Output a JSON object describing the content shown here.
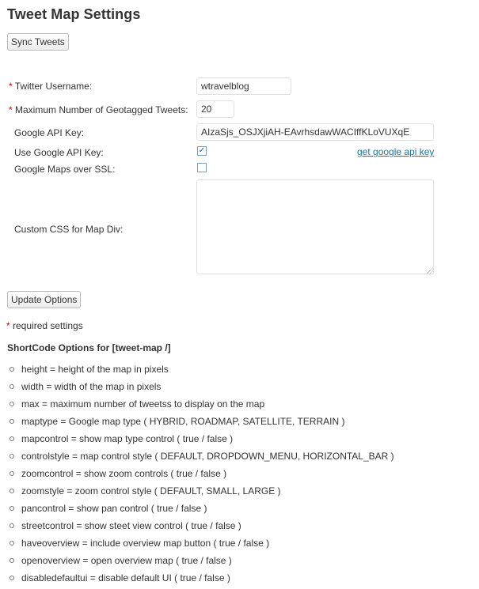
{
  "page": {
    "title": "Tweet Map Settings"
  },
  "sync_button": "Sync Tweets",
  "required_marker": "*",
  "form": {
    "twitter_username": {
      "label": "Twitter Username:",
      "value": "wtravelblog"
    },
    "max_tweets": {
      "label": "Maximum Number of Geotagged Tweets:",
      "value": "20"
    },
    "google_api_key": {
      "label": "Google API Key:",
      "value": "AIzaSjs_OSJXjiAH-EAvrhsdawWACIffKLoVUXqE"
    },
    "use_google_api_key": {
      "label": "Use Google API Key:",
      "checked": true,
      "link": "get google api key"
    },
    "maps_over_ssl": {
      "label": "Google Maps over SSL:",
      "checked": false
    },
    "custom_css": {
      "label": "Custom CSS for Map Div:",
      "value": ""
    }
  },
  "update_button": "Update Options",
  "required_note": "required settings",
  "shortcode": {
    "heading": "ShortCode Options for [tweet-map /]",
    "items": [
      "height = height of the map in pixels",
      "width = width of the map in pixels",
      "max = maximum number of tweetss to display on the map",
      "maptype = Google map type ( HYBRID, ROADMAP, SATELLITE, TERRAIN )",
      "mapcontrol = show map type control ( true / false )",
      "controlstyle = map control style ( DEFAULT, DROPDOWN_MENU, HORIZONTAL_BAR )",
      "zoomcontrol = show zoom controls ( true / false )",
      "zoomstyle = zoom control style ( DEFAULT, SMALL, LARGE )",
      "pancontrol = show pan control ( true / false )",
      "streetcontrol = show steet view control ( true / false )",
      "haveoverview = include overview map button ( true / false )",
      "openoverview = open overview map ( true / false )",
      "disabledefaultui = disable default UI ( true / false )"
    ]
  },
  "colors": {
    "required": "#cc0000",
    "link": "#21759b",
    "text": "#333333"
  }
}
